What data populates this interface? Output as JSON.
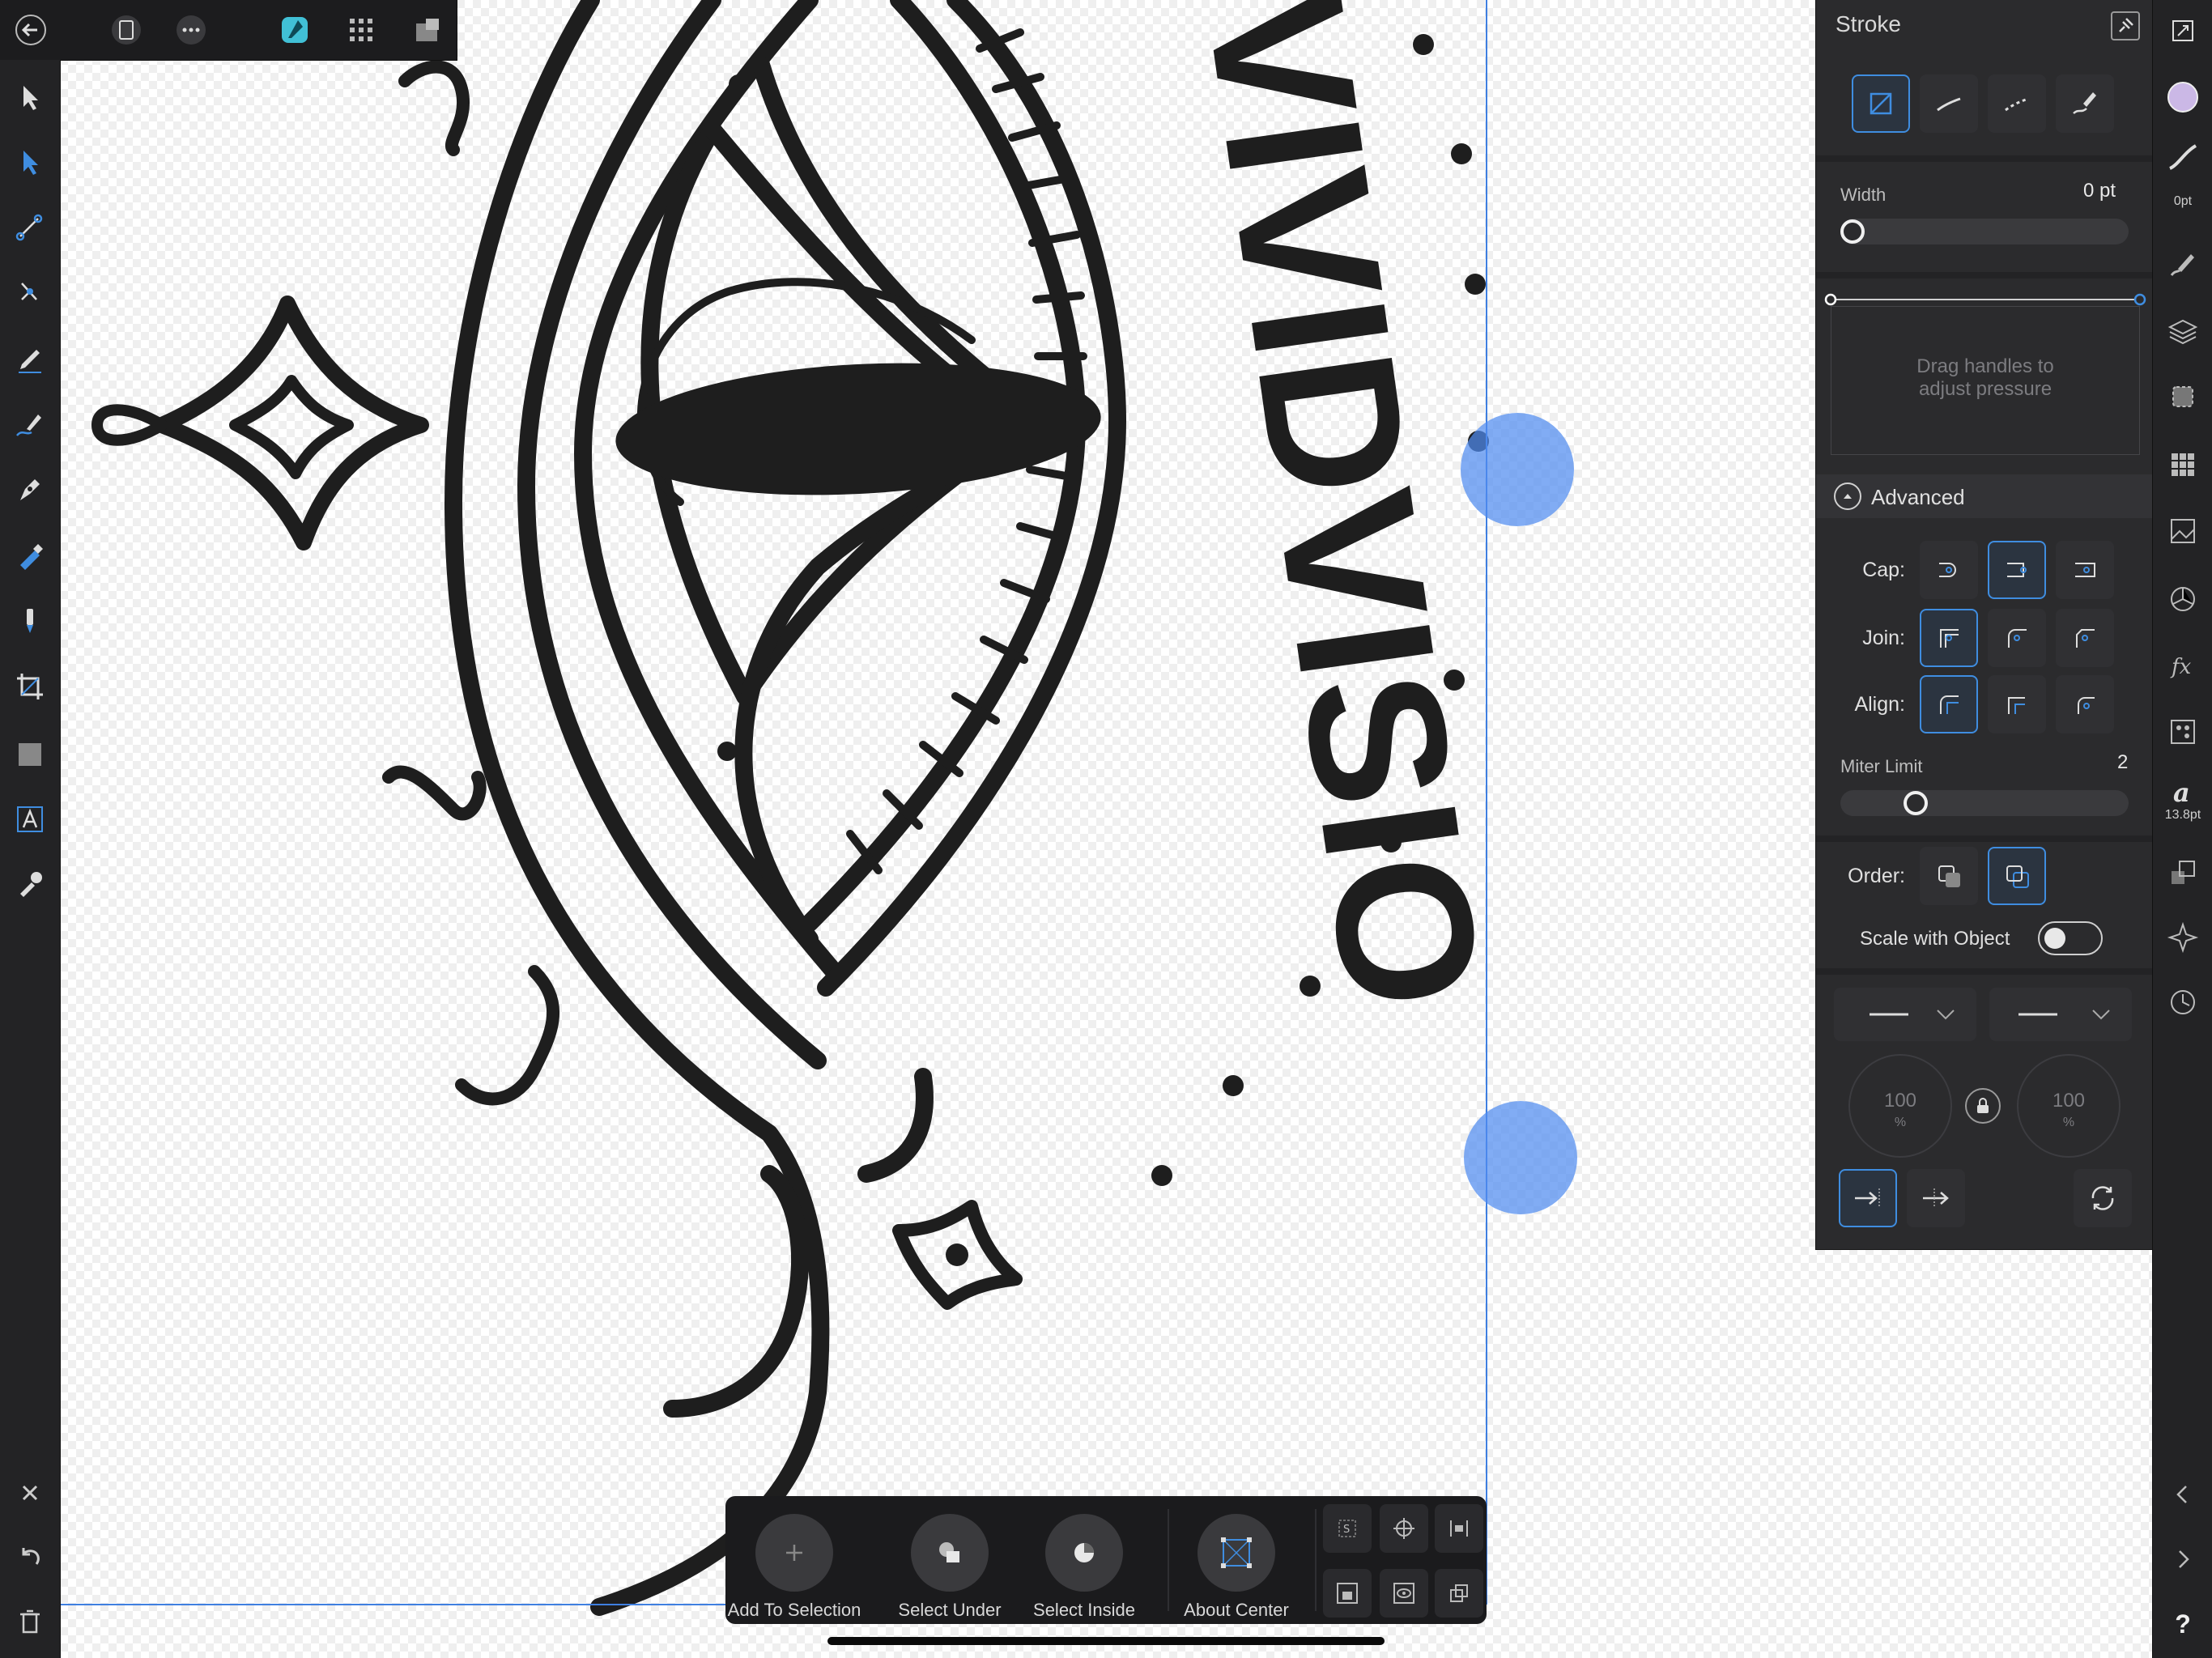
{
  "toolbar_top": {
    "icons": [
      "back-icon",
      "document-icon",
      "more-icon",
      "designer-persona-icon",
      "pixel-persona-icon",
      "export-persona-icon"
    ]
  },
  "tools": [
    "move-tool",
    "node-tool",
    "corner-tool",
    "point-transform-tool",
    "pencil-tool",
    "vector-brush-tool",
    "pen-tool",
    "fill-tool",
    "transparency-tool",
    "crop-tool",
    "shape-tool",
    "text-tool",
    "color-picker-tool"
  ],
  "bottom_left_actions": [
    "close-icon",
    "undo-icon",
    "trash-icon"
  ],
  "artwork": {
    "curved_text": "VIVIDVISIO"
  },
  "stroke_panel": {
    "title": "Stroke",
    "width_label": "Width",
    "width_value": "0 pt",
    "pressure_hint": "Drag handles to\nadjust pressure",
    "advanced_label": "Advanced",
    "cap_label": "Cap:",
    "join_label": "Join:",
    "align_label": "Align:",
    "miter_label": "Miter Limit",
    "miter_value": "2",
    "order_label": "Order:",
    "scale_label": "Scale with Object",
    "start_scale": "100",
    "end_scale": "100",
    "percent": "%",
    "colors": {
      "accent": "#3f8de0",
      "stroke_swatch": "#cbb8e6"
    }
  },
  "studio": {
    "stroke_width_badge": "0pt",
    "font_size_badge": "13.8pt",
    "help_label": "?"
  },
  "context_toolbar": {
    "add_to_selection": "Add To Selection",
    "select_under": "Select Under",
    "select_inside": "Select Inside",
    "about_center": "About Center"
  }
}
